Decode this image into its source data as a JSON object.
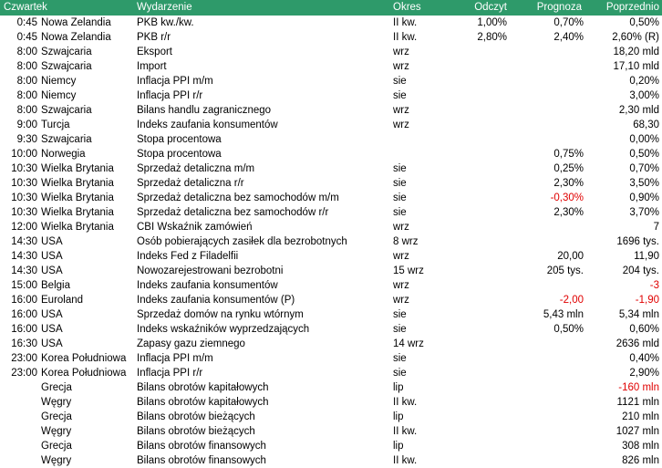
{
  "header": {
    "day": "Czwartek",
    "event": "Wydarzenie",
    "period": "Okres",
    "actual": "Odczyt",
    "forecast": "Prognoza",
    "previous": "Poprzednio"
  },
  "rows": [
    {
      "time": "0:45",
      "country": "Nowa Zelandia",
      "event": "PKB kw./kw.",
      "period": "II kw.",
      "actual": "1,00%",
      "forecast": "0,70%",
      "previous": "0,50%"
    },
    {
      "time": "0:45",
      "country": "Nowa Zelandia",
      "event": "PKB r/r",
      "period": "II kw.",
      "actual": "2,80%",
      "forecast": "2,40%",
      "previous": "2,60% (R)"
    },
    {
      "time": "8:00",
      "country": "Szwajcaria",
      "event": "Eksport",
      "period": "wrz",
      "actual": "",
      "forecast": "",
      "previous": "18,20 mld"
    },
    {
      "time": "8:00",
      "country": "Szwajcaria",
      "event": "Import",
      "period": "wrz",
      "actual": "",
      "forecast": "",
      "previous": "17,10 mld"
    },
    {
      "time": "8:00",
      "country": "Niemcy",
      "event": "Inflacja PPI m/m",
      "period": "sie",
      "actual": "",
      "forecast": "",
      "previous": "0,20%"
    },
    {
      "time": "8:00",
      "country": "Niemcy",
      "event": "Inflacja PPI r/r",
      "period": "sie",
      "actual": "",
      "forecast": "",
      "previous": "3,00%"
    },
    {
      "time": "8:00",
      "country": "Szwajcaria",
      "event": "Bilans handlu zagranicznego",
      "period": "wrz",
      "actual": "",
      "forecast": "",
      "previous": "2,30 mld"
    },
    {
      "time": "9:00",
      "country": "Turcja",
      "event": "Indeks zaufania konsumentów",
      "period": "wrz",
      "actual": "",
      "forecast": "",
      "previous": "68,30"
    },
    {
      "time": "9:30",
      "country": "Szwajcaria",
      "event": "Stopa procentowa",
      "period": "",
      "actual": "",
      "forecast": "",
      "previous": "0,00%"
    },
    {
      "time": "10:00",
      "country": "Norwegia",
      "event": "Stopa procentowa",
      "period": "",
      "actual": "",
      "forecast": "0,75%",
      "previous": "0,50%"
    },
    {
      "time": "10:30",
      "country": "Wielka Brytania",
      "event": "Sprzedaż detaliczna m/m",
      "period": "sie",
      "actual": "",
      "forecast": "0,25%",
      "previous": "0,70%"
    },
    {
      "time": "10:30",
      "country": "Wielka Brytania",
      "event": "Sprzedaż detaliczna r/r",
      "period": "sie",
      "actual": "",
      "forecast": "2,30%",
      "previous": "3,50%"
    },
    {
      "time": "10:30",
      "country": "Wielka Brytania",
      "event": "Sprzedaż detaliczna bez samochodów m/m",
      "period": "sie",
      "actual": "",
      "forecast": "-0,30%",
      "forecast_neg": true,
      "previous": "0,90%"
    },
    {
      "time": "10:30",
      "country": "Wielka Brytania",
      "event": "Sprzedaż detaliczna bez samochodów r/r",
      "period": "sie",
      "actual": "",
      "forecast": "2,30%",
      "previous": "3,70%"
    },
    {
      "time": "12:00",
      "country": "Wielka Brytania",
      "event": "CBI Wskaźnik zamówień",
      "period": "wrz",
      "actual": "",
      "forecast": "",
      "previous": "7"
    },
    {
      "time": "14:30",
      "country": "USA",
      "event": "Osób pobierających zasiłek dla bezrobotnych",
      "period": "8 wrz",
      "actual": "",
      "forecast": "",
      "previous": "1696 tys."
    },
    {
      "time": "14:30",
      "country": "USA",
      "event": "Indeks Fed z Filadelfii",
      "period": "wrz",
      "actual": "",
      "forecast": "20,00",
      "previous": "11,90"
    },
    {
      "time": "14:30",
      "country": "USA",
      "event": "Nowozarejestrowani bezrobotni",
      "period": "15 wrz",
      "actual": "",
      "forecast": "205 tys.",
      "previous": "204 tys."
    },
    {
      "time": "15:00",
      "country": "Belgia",
      "event": "Indeks zaufania konsumentów",
      "period": "wrz",
      "actual": "",
      "forecast": "",
      "previous": "-3",
      "previous_neg": true
    },
    {
      "time": "16:00",
      "country": "Euroland",
      "event": "Indeks zaufania konsumentów (P)",
      "period": "wrz",
      "actual": "",
      "forecast": "-2,00",
      "forecast_neg": true,
      "previous": "-1,90",
      "previous_neg": true
    },
    {
      "time": "16:00",
      "country": "USA",
      "event": "Sprzedaż domów na rynku wtórnym",
      "period": "sie",
      "actual": "",
      "forecast": "5,43 mln",
      "previous": "5,34 mln"
    },
    {
      "time": "16:00",
      "country": "USA",
      "event": "Indeks wskaźników wyprzedzających",
      "period": "sie",
      "actual": "",
      "forecast": "0,50%",
      "previous": "0,60%"
    },
    {
      "time": "16:30",
      "country": "USA",
      "event": "Zapasy gazu ziemnego",
      "period": "14 wrz",
      "actual": "",
      "forecast": "",
      "previous": "2636 mld"
    },
    {
      "time": "23:00",
      "country": "Korea Południowa",
      "event": "Inflacja PPI m/m",
      "period": "sie",
      "actual": "",
      "forecast": "",
      "previous": "0,40%"
    },
    {
      "time": "23:00",
      "country": "Korea Południowa",
      "event": "Inflacja PPI r/r",
      "period": "sie",
      "actual": "",
      "forecast": "",
      "previous": "2,90%"
    },
    {
      "time": "",
      "country": "Grecja",
      "event": "Bilans obrotów kapitałowych",
      "period": "lip",
      "actual": "",
      "forecast": "",
      "previous": "-160 mln",
      "previous_neg": true
    },
    {
      "time": "",
      "country": "Węgry",
      "event": "Bilans obrotów kapitałowych",
      "period": "II kw.",
      "actual": "",
      "forecast": "",
      "previous": "1121 mln"
    },
    {
      "time": "",
      "country": "Grecja",
      "event": "Bilans obrotów bieżących",
      "period": "lip",
      "actual": "",
      "forecast": "",
      "previous": "210 mln"
    },
    {
      "time": "",
      "country": "Węgry",
      "event": "Bilans obrotów bieżących",
      "period": "II kw.",
      "actual": "",
      "forecast": "",
      "previous": "1027 mln"
    },
    {
      "time": "",
      "country": "Grecja",
      "event": "Bilans obrotów finansowych",
      "period": "lip",
      "actual": "",
      "forecast": "",
      "previous": "308 mln"
    },
    {
      "time": "",
      "country": "Węgry",
      "event": "Bilans obrotów finansowych",
      "period": "II kw.",
      "actual": "",
      "forecast": "",
      "previous": "826 mln"
    }
  ]
}
